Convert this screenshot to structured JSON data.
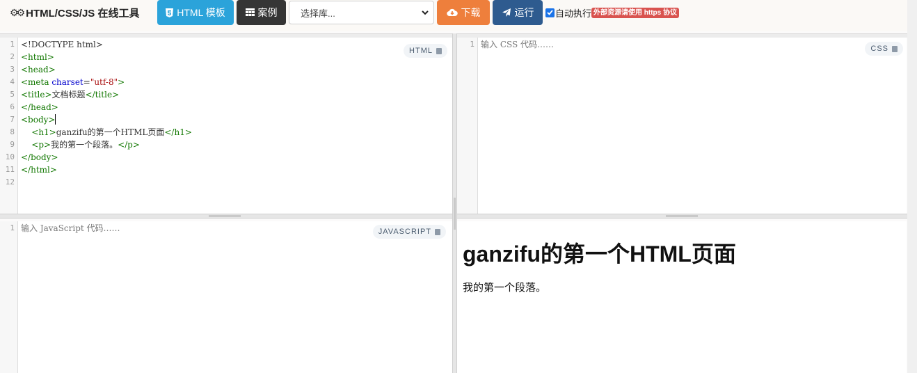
{
  "toolbar": {
    "title": "HTML/CSS/JS 在线工具",
    "template_label": "HTML 模板",
    "cases_label": "案例",
    "library_select": {
      "placeholder": "选择库..."
    },
    "download_label": "下载",
    "run_label": "运行",
    "auto_run_label": "自动执行",
    "auto_run_checked": true,
    "https_badge": "外部资源请使用 https 协议"
  },
  "html_editor": {
    "badge": "HTML",
    "line_numbers": [
      "1",
      "2",
      "3",
      "4",
      "5",
      "6",
      "7",
      "8",
      "9",
      "10",
      "11",
      "12"
    ],
    "lines": [
      "<!DOCTYPE html>",
      "<html>",
      "<head>",
      "<meta charset=\"utf-8\">",
      "<title>文档标题</title>",
      "</head>",
      "<body>",
      "    <h1>ganzifu的第一个HTML页面</h1>",
      "    <p>我的第一个段落。</p>",
      "</body>",
      "</html>",
      ""
    ]
  },
  "css_editor": {
    "badge": "CSS",
    "line_numbers": [
      "1"
    ],
    "placeholder": "输入 CSS 代码……"
  },
  "js_editor": {
    "badge": "JAVASCRIPT",
    "line_numbers": [
      "1"
    ],
    "placeholder": "输入 JavaScript 代码……"
  },
  "output": {
    "heading": "ganzifu的第一个HTML页面",
    "paragraph": "我的第一个段落。"
  },
  "colors": {
    "template_button": "#2ba3da",
    "cases_button": "#353535",
    "download_button": "#ee7f3c",
    "run_button": "#2e5b8f",
    "badge": "#d9534f"
  },
  "icons": {
    "brand": "gears-icon",
    "template": "html5-icon",
    "cases": "table-icon",
    "download": "cloud-download-icon",
    "run": "paper-plane-icon"
  }
}
